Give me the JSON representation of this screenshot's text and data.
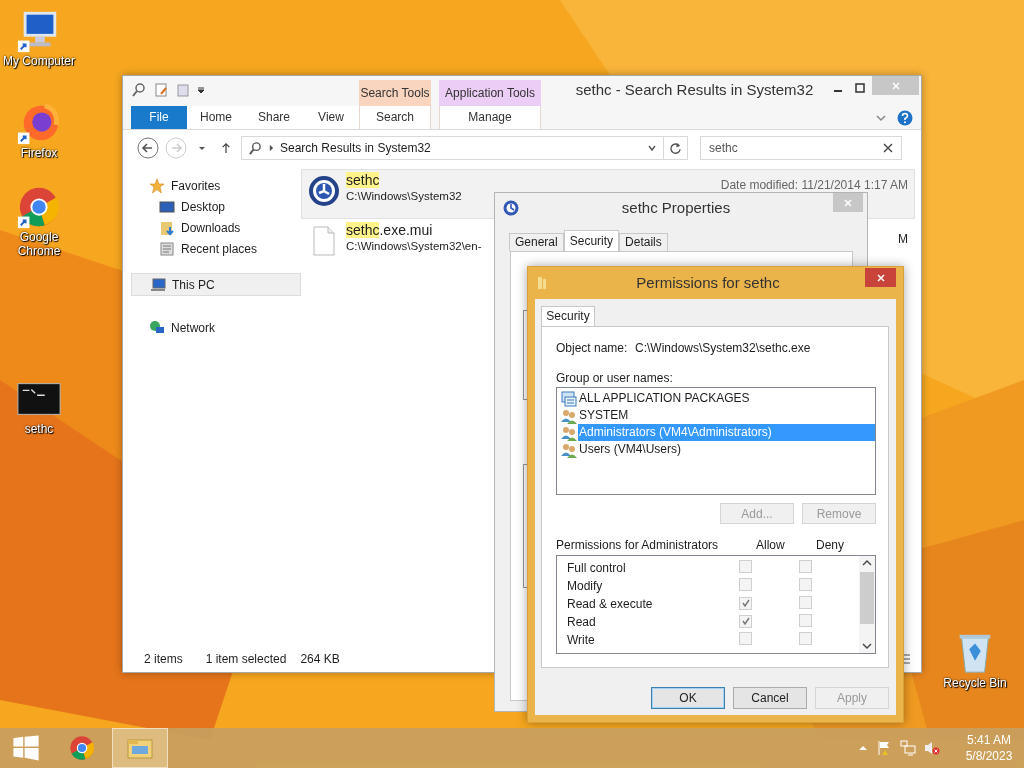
{
  "desktop_icons": [
    {
      "label": "My Computer",
      "kind": "computer"
    },
    {
      "label": "Firefox",
      "kind": "firefox"
    },
    {
      "label": "Google Chrome",
      "kind": "chrome"
    },
    {
      "label": "sethc",
      "kind": "console"
    }
  ],
  "recycle_bin": {
    "label": "Recycle Bin"
  },
  "explorer": {
    "title": "sethc - Search Results in System32",
    "context_groups": [
      {
        "group": "Search Tools",
        "tab": "Search",
        "color": "#f9d4bf"
      },
      {
        "group": "Application Tools",
        "tab": "Manage",
        "color": "#ebcdf5"
      }
    ],
    "file_tab": "File",
    "ribbon_tabs": [
      "Home",
      "Share",
      "View"
    ],
    "address": "Search Results in System32",
    "search": "sethc",
    "nav": [
      {
        "label": "Favorites",
        "kind": "star",
        "selected": false,
        "children": [
          {
            "label": "Desktop",
            "kind": "desktop",
            "selected": false
          },
          {
            "label": "Downloads",
            "kind": "downloads",
            "selected": false
          },
          {
            "label": "Recent places",
            "kind": "recent",
            "selected": false
          }
        ]
      },
      {
        "label": "This PC",
        "kind": "pc",
        "selected": true
      },
      {
        "label": "Network",
        "kind": "network",
        "selected": false
      }
    ],
    "files": [
      {
        "match": "sethc",
        "path": "C:\\Windows\\System32",
        "date": "Date modified: 11/21/2014 1:17 AM",
        "kind": "exe",
        "selected": true
      },
      {
        "match": "sethc",
        "rest": ".exe.mui",
        "path": "C:\\Windows\\System32\\en-",
        "date": "M",
        "kind": "file",
        "selected": false
      }
    ],
    "status": {
      "count": "2 items",
      "selection": "1 item selected",
      "size": "264 KB"
    }
  },
  "properties": {
    "title": "sethc Properties",
    "tabs": [
      {
        "label": "General",
        "selected": false
      },
      {
        "label": "Security",
        "selected": true
      },
      {
        "label": "Details",
        "selected": false
      }
    ]
  },
  "permissions": {
    "title": "Permissions for sethc",
    "tab": "Security",
    "object_label": "Object name:",
    "object_value": "C:\\Windows\\System32\\sethc.exe",
    "groups_label": "Group or user names:",
    "groups": [
      {
        "name": "ALL APPLICATION PACKAGES",
        "kind": "package",
        "selected": false
      },
      {
        "name": "SYSTEM",
        "kind": "users",
        "selected": false
      },
      {
        "name": "Administrators (VM4\\Administrators)",
        "kind": "users",
        "selected": true
      },
      {
        "name": "Users (VM4\\Users)",
        "kind": "users",
        "selected": false
      }
    ],
    "list_buttons": [
      {
        "label": "Add...",
        "disabled": true
      },
      {
        "label": "Remove",
        "disabled": true
      }
    ],
    "perms_label": "Permissions for Administrators",
    "allow_label": "Allow",
    "deny_label": "Deny",
    "perms": [
      {
        "name": "Full control",
        "allow": false,
        "deny": false
      },
      {
        "name": "Modify",
        "allow": false,
        "deny": false
      },
      {
        "name": "Read & execute",
        "allow": true,
        "deny": false
      },
      {
        "name": "Read",
        "allow": true,
        "deny": false
      },
      {
        "name": "Write",
        "allow": false,
        "deny": false
      }
    ],
    "buttons": [
      {
        "label": "OK",
        "disabled": false
      },
      {
        "label": "Cancel",
        "disabled": false
      },
      {
        "label": "Apply",
        "disabled": true
      }
    ]
  },
  "taskbar": {
    "apps": [
      {
        "kind": "start",
        "selected": false
      },
      {
        "kind": "chrome",
        "selected": false
      },
      {
        "kind": "explorer",
        "selected": true
      }
    ],
    "time": "5:41 AM",
    "date": "5/8/2023"
  }
}
